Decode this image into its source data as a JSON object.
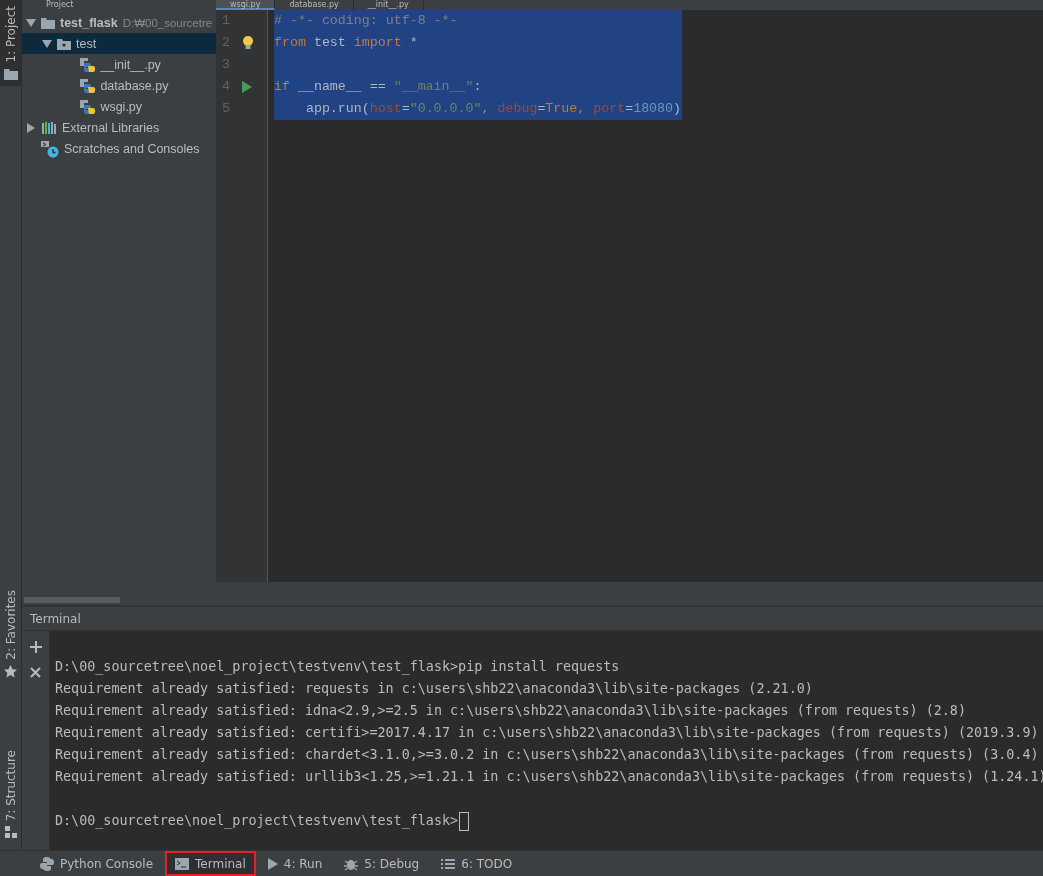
{
  "top_bar": {
    "panel_title": "Project",
    "tabs": [
      {
        "label": "wsgi.py",
        "selected": true
      },
      {
        "label": "database.py",
        "selected": false
      },
      {
        "label": "__init__.py",
        "selected": false
      }
    ]
  },
  "tool_strip": {
    "top": [
      {
        "label": "1: Project",
        "selected": true
      }
    ],
    "bottom": [
      {
        "label": "2: Favorites",
        "selected": false
      },
      {
        "label": "7: Structure",
        "selected": false
      }
    ]
  },
  "project_tree": [
    {
      "label": "test_flask",
      "detail": "D:₩00_sourcetre",
      "kind": "folder",
      "expanded": true,
      "selected": false,
      "children": [
        {
          "label": "test",
          "kind": "package",
          "expanded": true,
          "selected": true,
          "children": [
            {
              "label": "__init__.py",
              "kind": "python",
              "selected": false
            },
            {
              "label": "database.py",
              "kind": "python",
              "selected": false
            },
            {
              "label": "wsgi.py",
              "kind": "python",
              "selected": false
            }
          ]
        }
      ]
    },
    {
      "label": "External Libraries",
      "kind": "libraries",
      "expanded": false,
      "selected": false
    },
    {
      "label": "Scratches and Consoles",
      "kind": "scratches",
      "selected": false
    }
  ],
  "editor": {
    "selected": true,
    "lines": [
      {
        "number": "1",
        "run": false,
        "intention": false,
        "tokens": [
          {
            "text": "# -*- coding: utf-8 -*-",
            "kind": "comment"
          }
        ]
      },
      {
        "number": "2",
        "run": false,
        "intention": true,
        "tokens": [
          {
            "text": "from",
            "kind": "keyword"
          },
          {
            "text": " test ",
            "kind": "plain"
          },
          {
            "text": "import",
            "kind": "keyword"
          },
          {
            "text": " *",
            "kind": "plain"
          }
        ]
      },
      {
        "number": "3",
        "run": false,
        "intention": false
      },
      {
        "number": "4",
        "run": true,
        "intention": false,
        "tokens": [
          {
            "text": "if",
            "kind": "keyword"
          },
          {
            "text": " __name__ == ",
            "kind": "plain"
          },
          {
            "text": "\"__main__\"",
            "kind": "string"
          },
          {
            "text": ":",
            "kind": "plain"
          }
        ]
      },
      {
        "number": "5",
        "run": false,
        "intention": false,
        "tokens": [
          {
            "text": "    app.run(",
            "kind": "plain"
          },
          {
            "text": "host",
            "kind": "param"
          },
          {
            "text": "=",
            "kind": "plain"
          },
          {
            "text": "\"0.0.0.0\"",
            "kind": "string"
          },
          {
            "text": ", ",
            "kind": "keyword"
          },
          {
            "text": "debug",
            "kind": "param"
          },
          {
            "text": "=",
            "kind": "plain"
          },
          {
            "text": "True",
            "kind": "keyword"
          },
          {
            "text": ", ",
            "kind": "keyword"
          },
          {
            "text": "port",
            "kind": "param"
          },
          {
            "text": "=",
            "kind": "plain"
          },
          {
            "text": "18080",
            "kind": "number"
          },
          {
            "text": ")",
            "kind": "plain"
          }
        ]
      }
    ]
  },
  "terminal": {
    "title": "Terminal",
    "lines": [
      {
        "text": "D:\\00_sourcetree\\noel_project\\testvenv\\test_flask>pip install requests",
        "cursor": false
      },
      {
        "text": "Requirement already satisfied: requests in c:\\users\\shb22\\anaconda3\\lib\\site-packages (2.21.0)",
        "cursor": false
      },
      {
        "text": "Requirement already satisfied: idna<2.9,>=2.5 in c:\\users\\shb22\\anaconda3\\lib\\site-packages (from requests) (2.8)",
        "cursor": false
      },
      {
        "text": "Requirement already satisfied: certifi>=2017.4.17 in c:\\users\\shb22\\anaconda3\\lib\\site-packages (from requests) (2019.3.9)",
        "cursor": false
      },
      {
        "text": "Requirement already satisfied: chardet<3.1.0,>=3.0.2 in c:\\users\\shb22\\anaconda3\\lib\\site-packages (from requests) (3.0.4)",
        "cursor": false
      },
      {
        "text": "Requirement already satisfied: urllib3<1.25,>=1.21.1 in c:\\users\\shb22\\anaconda3\\lib\\site-packages (from requests) (1.24.1)",
        "cursor": false
      },
      {
        "text": "D:\\00_sourcetree\\noel_project\\testvenv\\test_flask>",
        "cursor": true,
        "gap_before": true
      }
    ]
  },
  "bottom_bar": [
    {
      "label": "Python Console",
      "selected": false,
      "highlighted": false
    },
    {
      "label": "Terminal",
      "selected": true,
      "highlighted": true
    },
    {
      "label": "4: Run",
      "selected": false,
      "highlighted": false
    },
    {
      "label": "5: Debug",
      "selected": false,
      "highlighted": false
    },
    {
      "label": "6: TODO",
      "selected": false,
      "highlighted": false
    }
  ]
}
